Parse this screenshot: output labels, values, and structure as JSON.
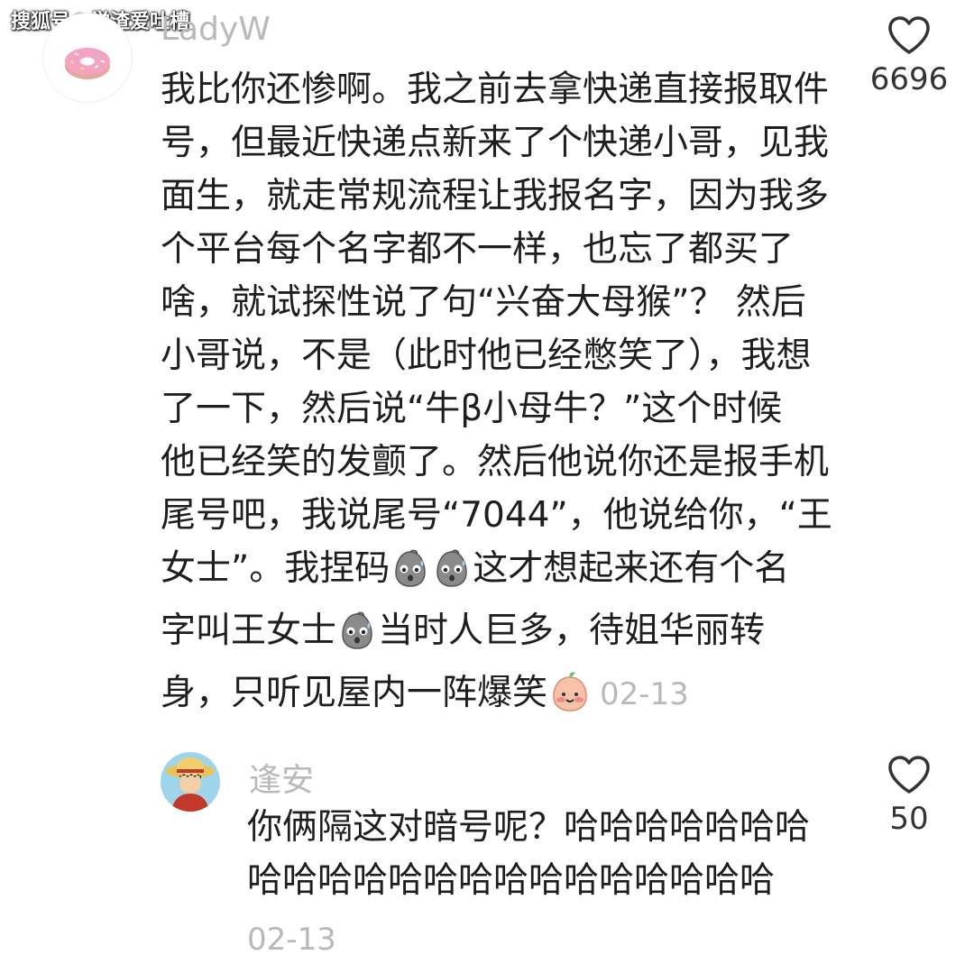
{
  "watermark": "搜狐号@学渣爱吐槽",
  "main_comment": {
    "username": "LadyW",
    "lines": [
      "我比你还惨啊。我之前去拿快递直接报取件",
      "号，但最近快递点新来了个快递小哥，见我",
      "面生，就走常规流程让我报名字，因为我多",
      "个平台每个名字都不一样，也忘了都买了",
      "啥，就试探性说了句“兴奋大母猴”？ 然后",
      "小哥说，不是（此时他已经憋笑了），我想",
      "了一下，然后说“牛β小母牛？”这个时候",
      "他已经笑的发颤了。然后他说你还是报手机",
      "尾号吧，我说尾号“7044”，他说给你，“王"
    ],
    "line10_part1": "女士”。我捏码",
    "line10_part2": "这才想起来还有个名",
    "line11_part1": "字叫王女士",
    "line11_part2": "当时人巨多，待姐华丽转",
    "line12_part1": "身，只听见屋内一阵爆笑",
    "date": "02-13",
    "like_count": "6696"
  },
  "reply_comment": {
    "username": "逢安",
    "lines": [
      "你俩隔这对暗号呢？哈哈哈哈哈哈哈",
      "哈哈哈哈哈哈哈哈哈哈哈哈哈哈哈"
    ],
    "date": "02-13",
    "like_count": "50"
  },
  "icons": {
    "avatar_main": "donut-avatar",
    "avatar_reply": "anime-character-avatar",
    "like": "heart-outline-icon",
    "emoji_sweat": "sweating-grey-face-emoji",
    "emoji_laugh": "blushing-peach-face-emoji"
  },
  "colors": {
    "text": "#1e1e1e",
    "muted": "#b9b9b9",
    "like_count": "#333333",
    "background": "#ffffff"
  }
}
